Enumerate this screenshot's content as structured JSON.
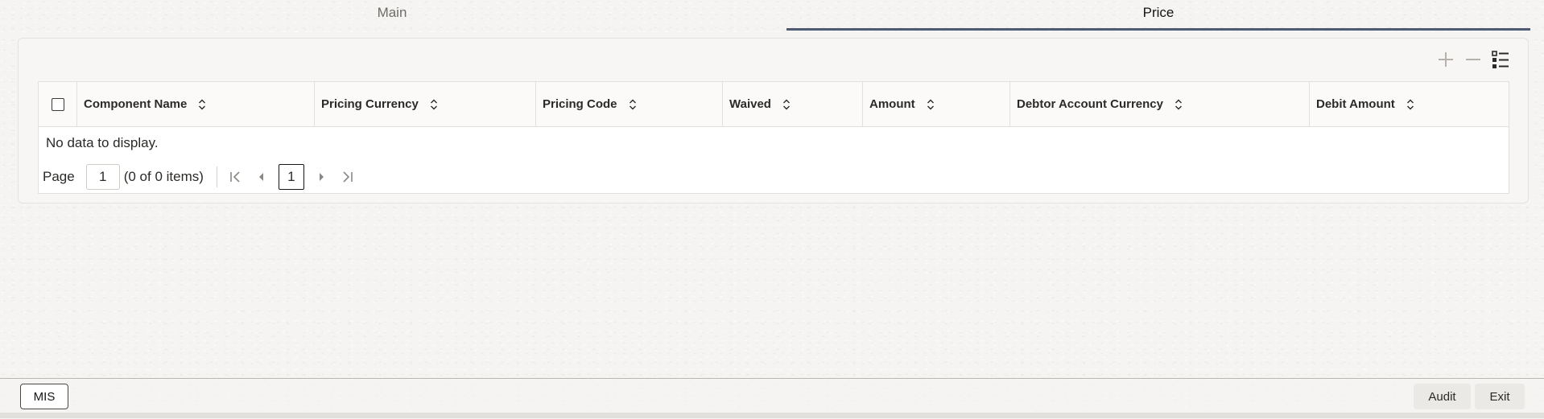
{
  "tabs": [
    {
      "label": "Main",
      "active": false
    },
    {
      "label": "Price",
      "active": true
    }
  ],
  "toolbar": {
    "icons": [
      "add-icon",
      "remove-icon",
      "column-list-icon"
    ]
  },
  "grid": {
    "columns": [
      "Component Name",
      "Pricing Currency",
      "Pricing Code",
      "Waived",
      "Amount",
      "Debtor Account Currency",
      "Debit Amount"
    ],
    "empty_message": "No data to display."
  },
  "pager": {
    "label": "Page",
    "page_input_value": "1",
    "item_count": "(0 of 0 items)",
    "current_page": "1"
  },
  "footer": {
    "mis_label": "MIS",
    "audit_label": "Audit",
    "exit_label": "Exit"
  },
  "colors": {
    "active_tab_underline": "#4f5a73",
    "background": "#f5f4f2"
  }
}
